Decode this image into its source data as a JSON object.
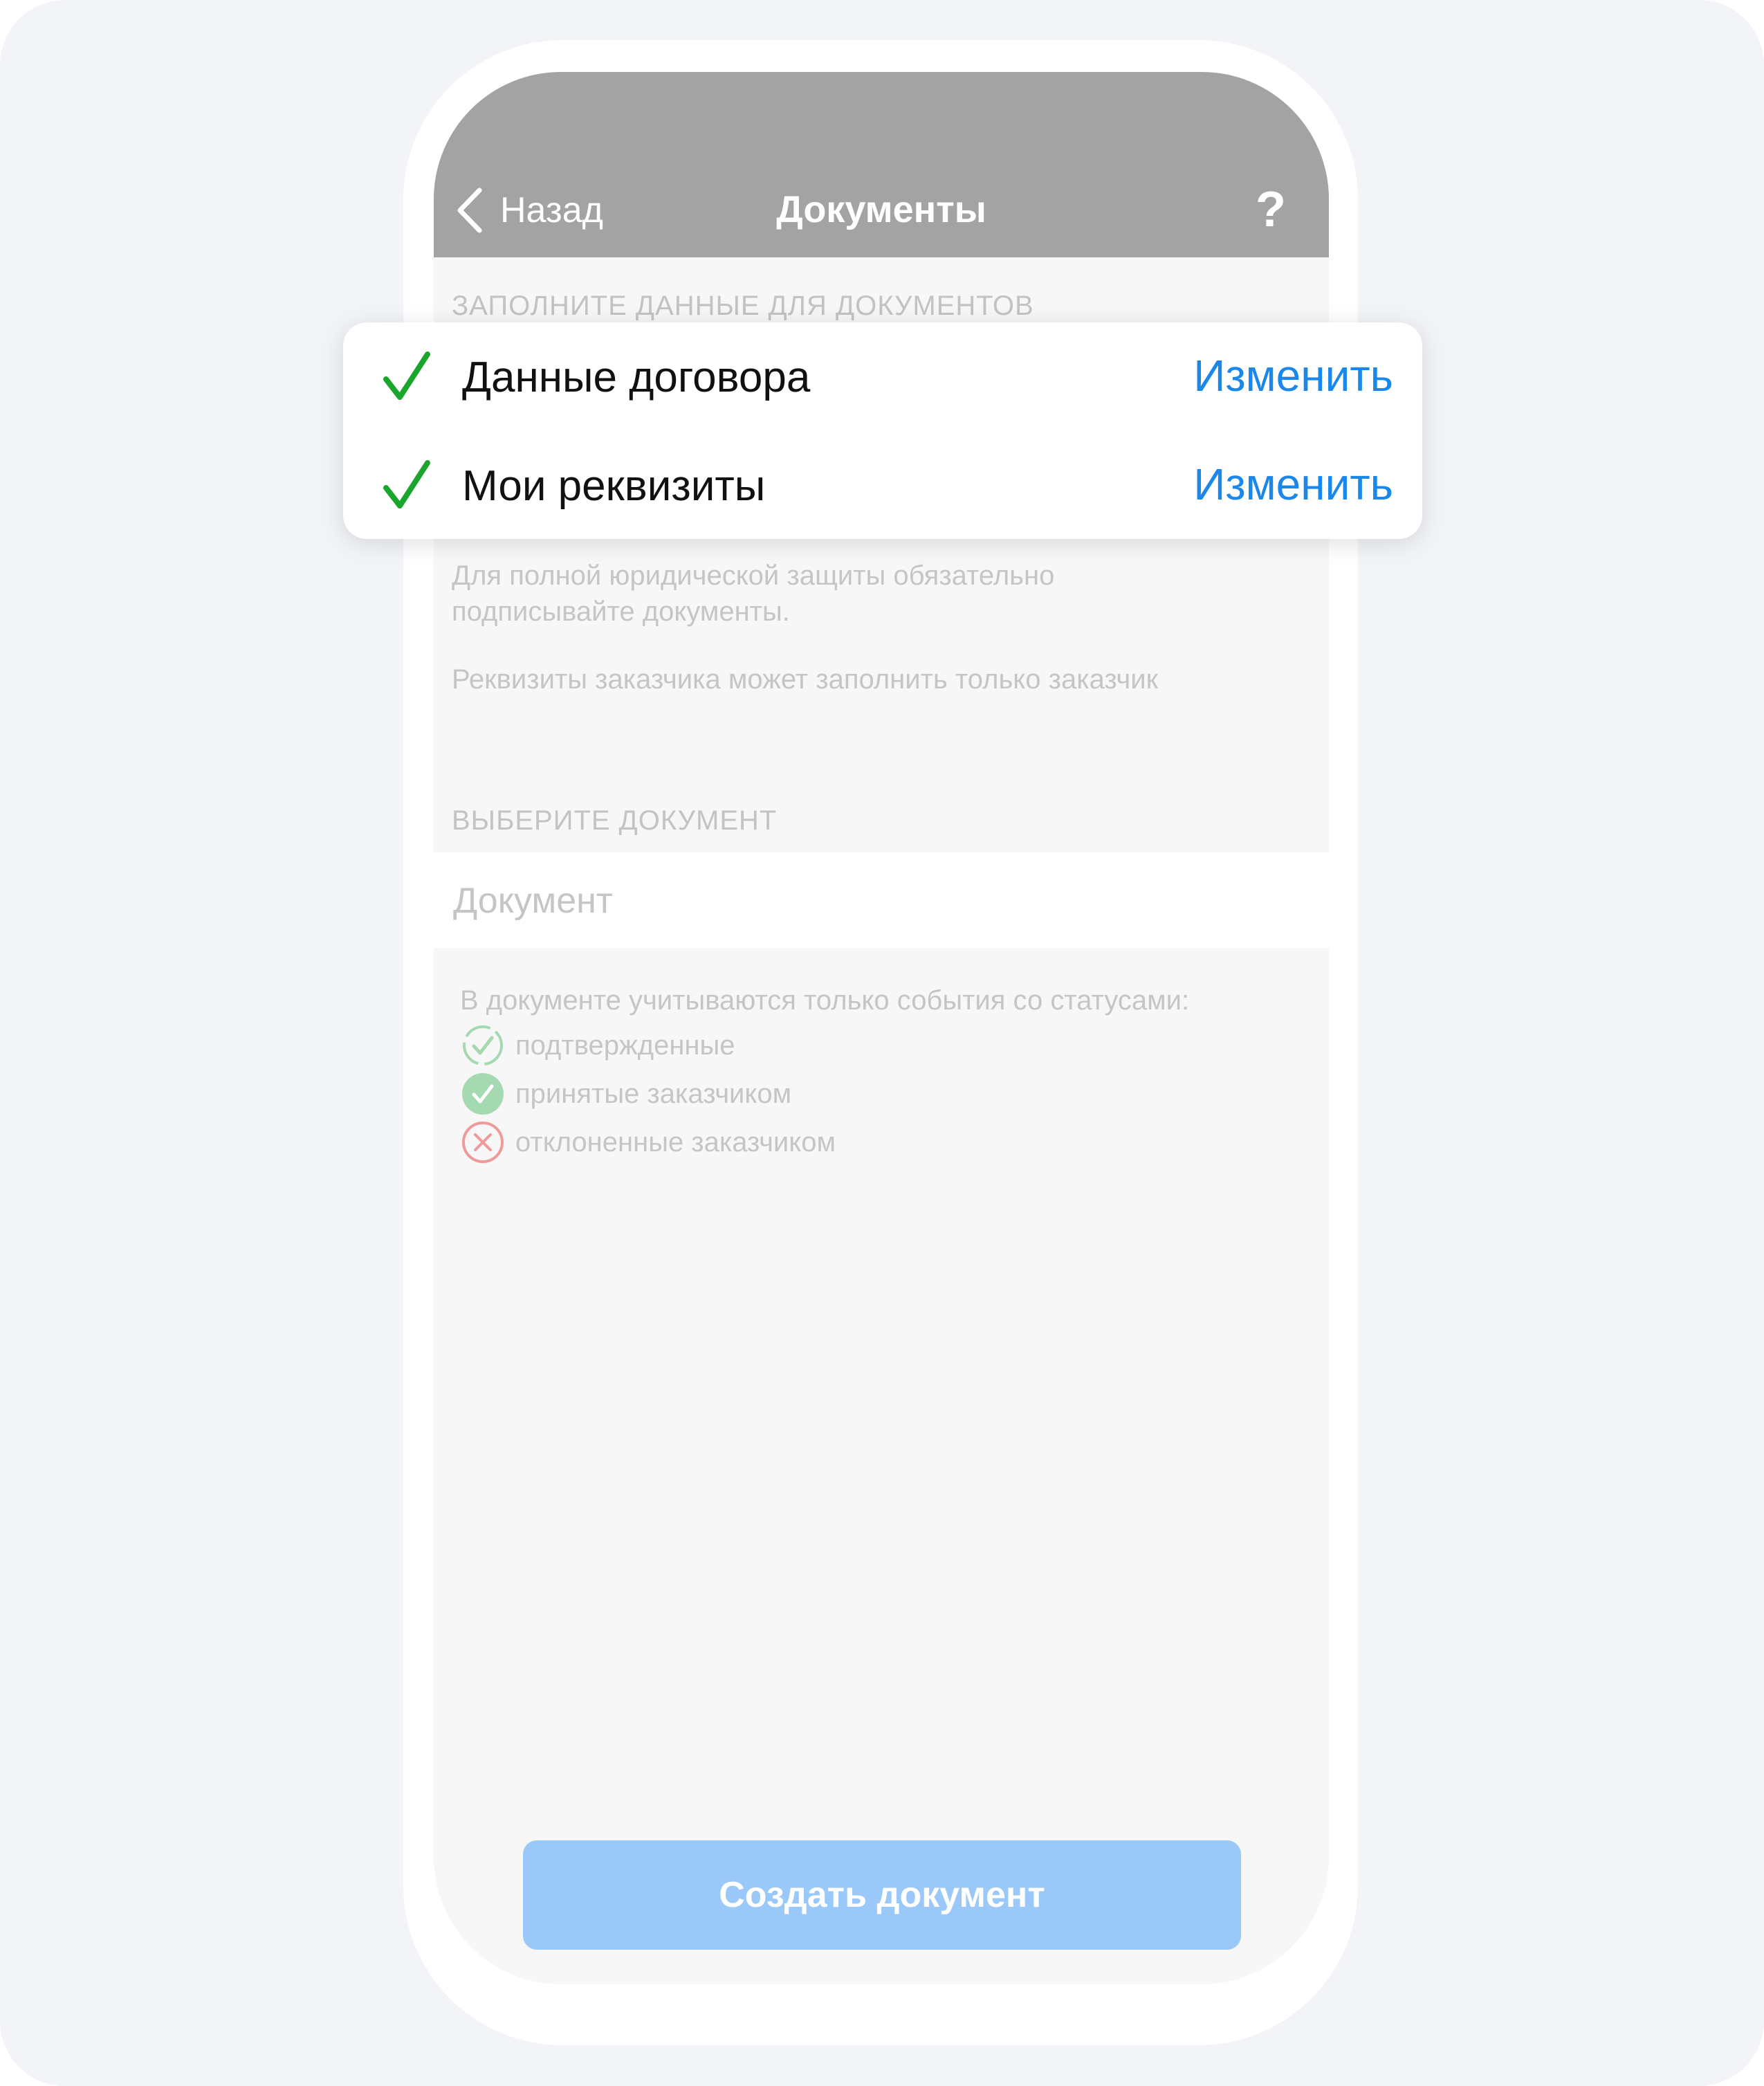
{
  "nav": {
    "back_label": "Назад",
    "title": "Документы",
    "help_label": "?"
  },
  "fill_section": {
    "header": "ЗАПОЛНИТЕ ДАННЫЕ ДЛЯ ДОКУМЕНТОВ",
    "items": [
      {
        "label": "Данные договора",
        "action": "Изменить",
        "status_icon": "check-icon",
        "completed": true
      },
      {
        "label": "Мои реквизиты",
        "action": "Изменить",
        "status_icon": "check-icon",
        "completed": true
      }
    ],
    "hint_line1": "Для полной юридической защиты обязательно",
    "hint_line2": "подписывайте документы.",
    "hint2": "Реквизиты заказчика может заполнить только заказчик"
  },
  "doc_section": {
    "header": "ВЫБЕРИТЕ ДОКУМЕНТ",
    "field_placeholder": "Документ",
    "legend_title": "В документе учитываются только события со статусами:",
    "legend": [
      {
        "icon": "pending-check-icon",
        "label": "подтвержденные"
      },
      {
        "icon": "accepted-check-icon",
        "label": "принятые заказчиком"
      },
      {
        "icon": "rejected-cross-icon",
        "label": "отклоненные заказчиком"
      }
    ]
  },
  "create_button_label": "Создать документ",
  "colors": {
    "accent": "#1a87ea",
    "button_disabled": "#9ac8f9",
    "nav_overlay": "#a3a3a3",
    "check_green": "#1aa52c",
    "accepted_green": "#a5d9b1",
    "rejected_red": "#ef9a9a"
  }
}
